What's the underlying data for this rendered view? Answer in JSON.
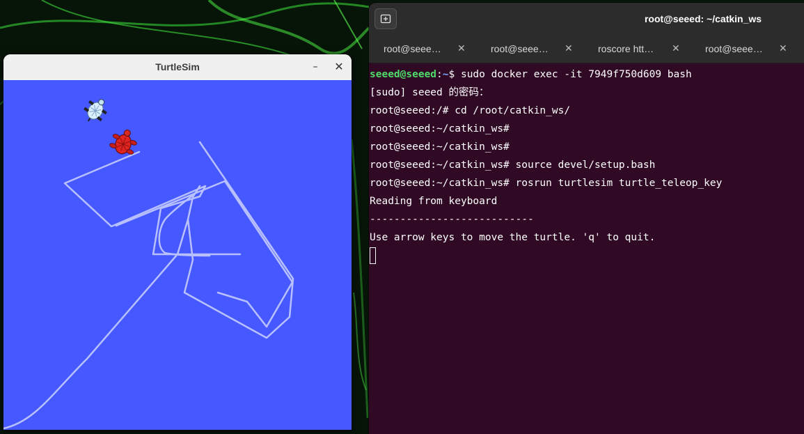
{
  "turtlesim": {
    "title": "TurtleSim",
    "minimize_symbol": "–",
    "close_symbol": "✕",
    "background_color": "#4658ff",
    "trail_color": "#b8c0ff"
  },
  "terminal": {
    "title": "root@seeed: ~/catkin_ws",
    "tabs": [
      {
        "label": "root@seee…"
      },
      {
        "label": "root@seee…"
      },
      {
        "label": "roscore htt…"
      },
      {
        "label": "root@seee…"
      }
    ],
    "tab_close_symbol": "✕",
    "first_prompt": {
      "user": "seeed@seeed",
      "sep": ":",
      "path": "~",
      "dollar": "$ ",
      "command": "sudo docker exec -it 7949f750d609 bash"
    },
    "lines": [
      "[sudo] seeed 的密码：",
      "root@seeed:/# cd /root/catkin_ws/",
      "root@seeed:~/catkin_ws#",
      "root@seeed:~/catkin_ws#",
      "root@seeed:~/catkin_ws# source devel/setup.bash",
      "root@seeed:~/catkin_ws# rosrun turtlesim turtle_teleop_key",
      "Reading from keyboard",
      "---------------------------",
      "Use arrow keys to move the turtle. 'q' to quit."
    ]
  }
}
